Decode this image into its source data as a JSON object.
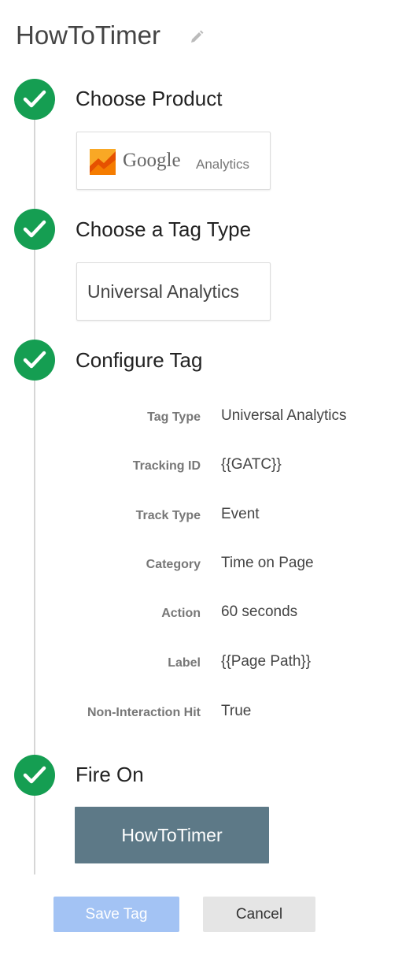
{
  "header": {
    "title": "HowToTimer",
    "edit_icon": "pencil-icon"
  },
  "steps": [
    {
      "title": "Choose Product",
      "status_icon": "check-circle-icon"
    },
    {
      "title": "Choose a Tag Type",
      "status_icon": "check-circle-icon"
    },
    {
      "title": "Configure Tag",
      "status_icon": "check-circle-icon"
    },
    {
      "title": "Fire On",
      "status_icon": "check-circle-icon"
    }
  ],
  "product": {
    "logo_icon": "google-analytics-logo-icon",
    "brand": "Google",
    "product": "Analytics"
  },
  "tag_type": {
    "label": "Universal Analytics"
  },
  "config": [
    {
      "label": "Tag Type",
      "value": "Universal Analytics"
    },
    {
      "label": "Tracking ID",
      "value": "{{GATC}}"
    },
    {
      "label": "Track Type",
      "value": "Event"
    },
    {
      "label": "Category",
      "value": "Time on Page"
    },
    {
      "label": "Action",
      "value": "60 seconds"
    },
    {
      "label": "Label",
      "value": "{{Page Path}}"
    },
    {
      "label": "Non-Interaction Hit",
      "value": "True"
    }
  ],
  "trigger": {
    "label": "HowToTimer"
  },
  "actions": {
    "save_label": "Save Tag",
    "cancel_label": "Cancel"
  },
  "colors": {
    "check": "#159e52",
    "trigger": "#5d7987",
    "save": "#a3c3f4",
    "cancel": "#e5e5e5"
  }
}
